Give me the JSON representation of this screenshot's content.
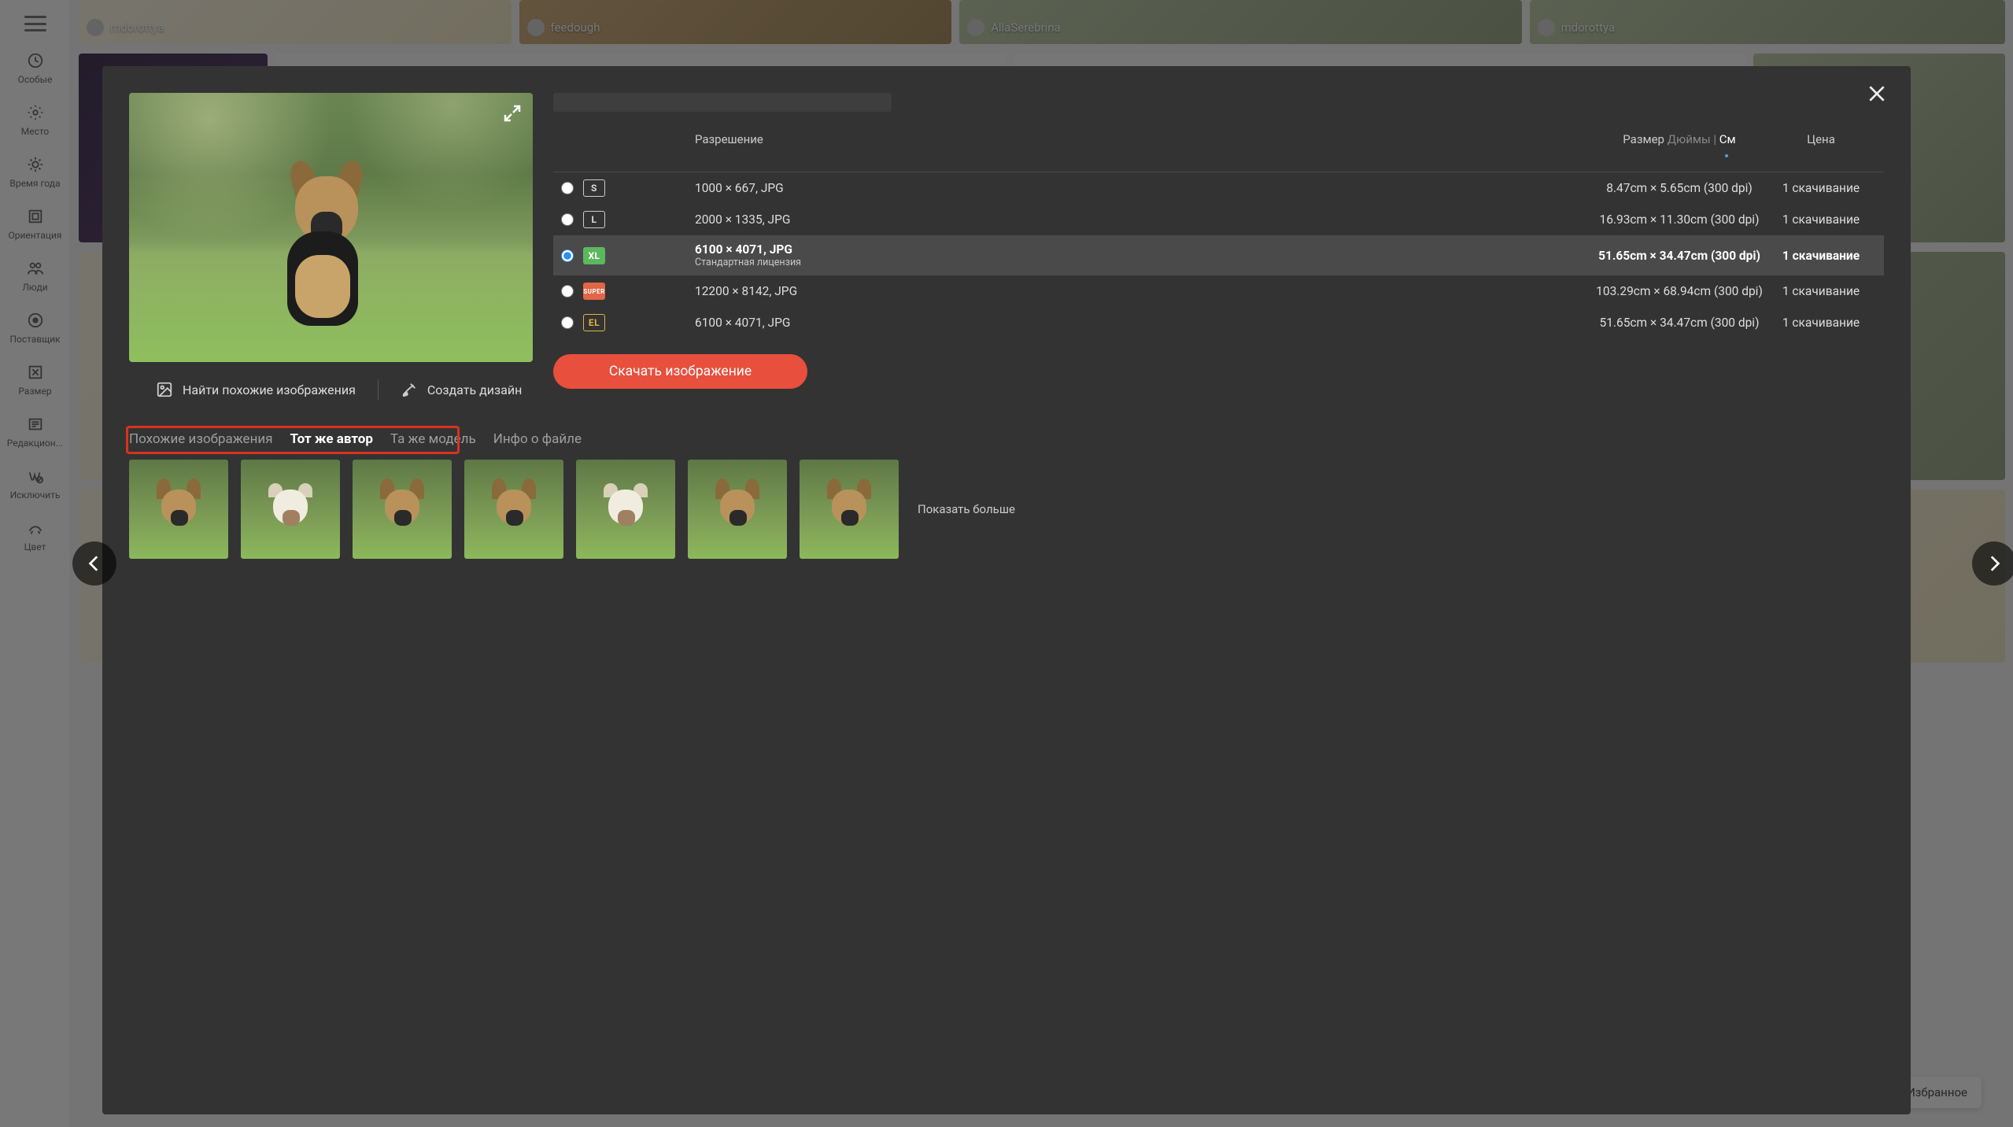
{
  "sidebar": {
    "items": [
      {
        "label": "Особые",
        "icon": "compass-icon"
      },
      {
        "label": "Место",
        "icon": "location-icon"
      },
      {
        "label": "Время года",
        "icon": "season-icon"
      },
      {
        "label": "Ориентация",
        "icon": "orientation-icon"
      },
      {
        "label": "Люди",
        "icon": "people-icon"
      },
      {
        "label": "Поставщик",
        "icon": "supplier-icon"
      },
      {
        "label": "Размер",
        "icon": "size-icon"
      },
      {
        "label": "Редакцион...",
        "icon": "editorial-icon"
      },
      {
        "label": "Исключить",
        "icon": "exclude-icon"
      },
      {
        "label": "Цвет",
        "icon": "color-icon"
      }
    ]
  },
  "background_tags": [
    {
      "name": "mdorottya"
    },
    {
      "name": "feedough"
    },
    {
      "name": "AllaSerebrina"
    },
    {
      "name": "mdorottya"
    }
  ],
  "favorite_pill": "Избранное",
  "modal": {
    "price_table": {
      "headers": {
        "resolution": "Разрешение",
        "size_prefix": "Размер",
        "unit_inches": "Дюймы",
        "unit_cm": "См",
        "price": "Цена"
      },
      "rows": [
        {
          "badge": "S",
          "badge_class": "s",
          "res": "1000 × 667, JPG",
          "size": "8.47cm × 5.65cm (300 dpi)",
          "price": "1 скачивание",
          "selected": false
        },
        {
          "badge": "L",
          "badge_class": "l",
          "res": "2000 × 1335, JPG",
          "size": "16.93cm × 11.30cm (300 dpi)",
          "price": "1 скачивание",
          "selected": false
        },
        {
          "badge": "XL",
          "badge_class": "xl",
          "res": "6100 × 4071, JPG",
          "sub": "Стандартная лицензия",
          "size": "51.65cm × 34.47cm (300 dpi)",
          "price": "1 скачивание",
          "selected": true
        },
        {
          "badge": "SUPER",
          "badge_class": "super",
          "res": "12200 × 8142, JPG",
          "size": "103.29cm × 68.94cm (300 dpi)",
          "price": "1 скачивание",
          "selected": false
        },
        {
          "badge": "EL",
          "badge_class": "el",
          "res": "6100 × 4071, JPG",
          "size": "51.65cm × 34.47cm (300 dpi)",
          "price": "1 скачивание",
          "selected": false
        }
      ]
    },
    "download_button": "Скачать изображение",
    "actions": {
      "find_similar": "Найти похожие изображения",
      "create_design": "Создать дизайн"
    },
    "tabs": {
      "similar": "Похожие изображения",
      "same_author": "Тот же автор",
      "same_model": "Та же модель",
      "file_info": "Инфо о файле",
      "active": "same_author"
    },
    "show_more": "Показать больше"
  }
}
